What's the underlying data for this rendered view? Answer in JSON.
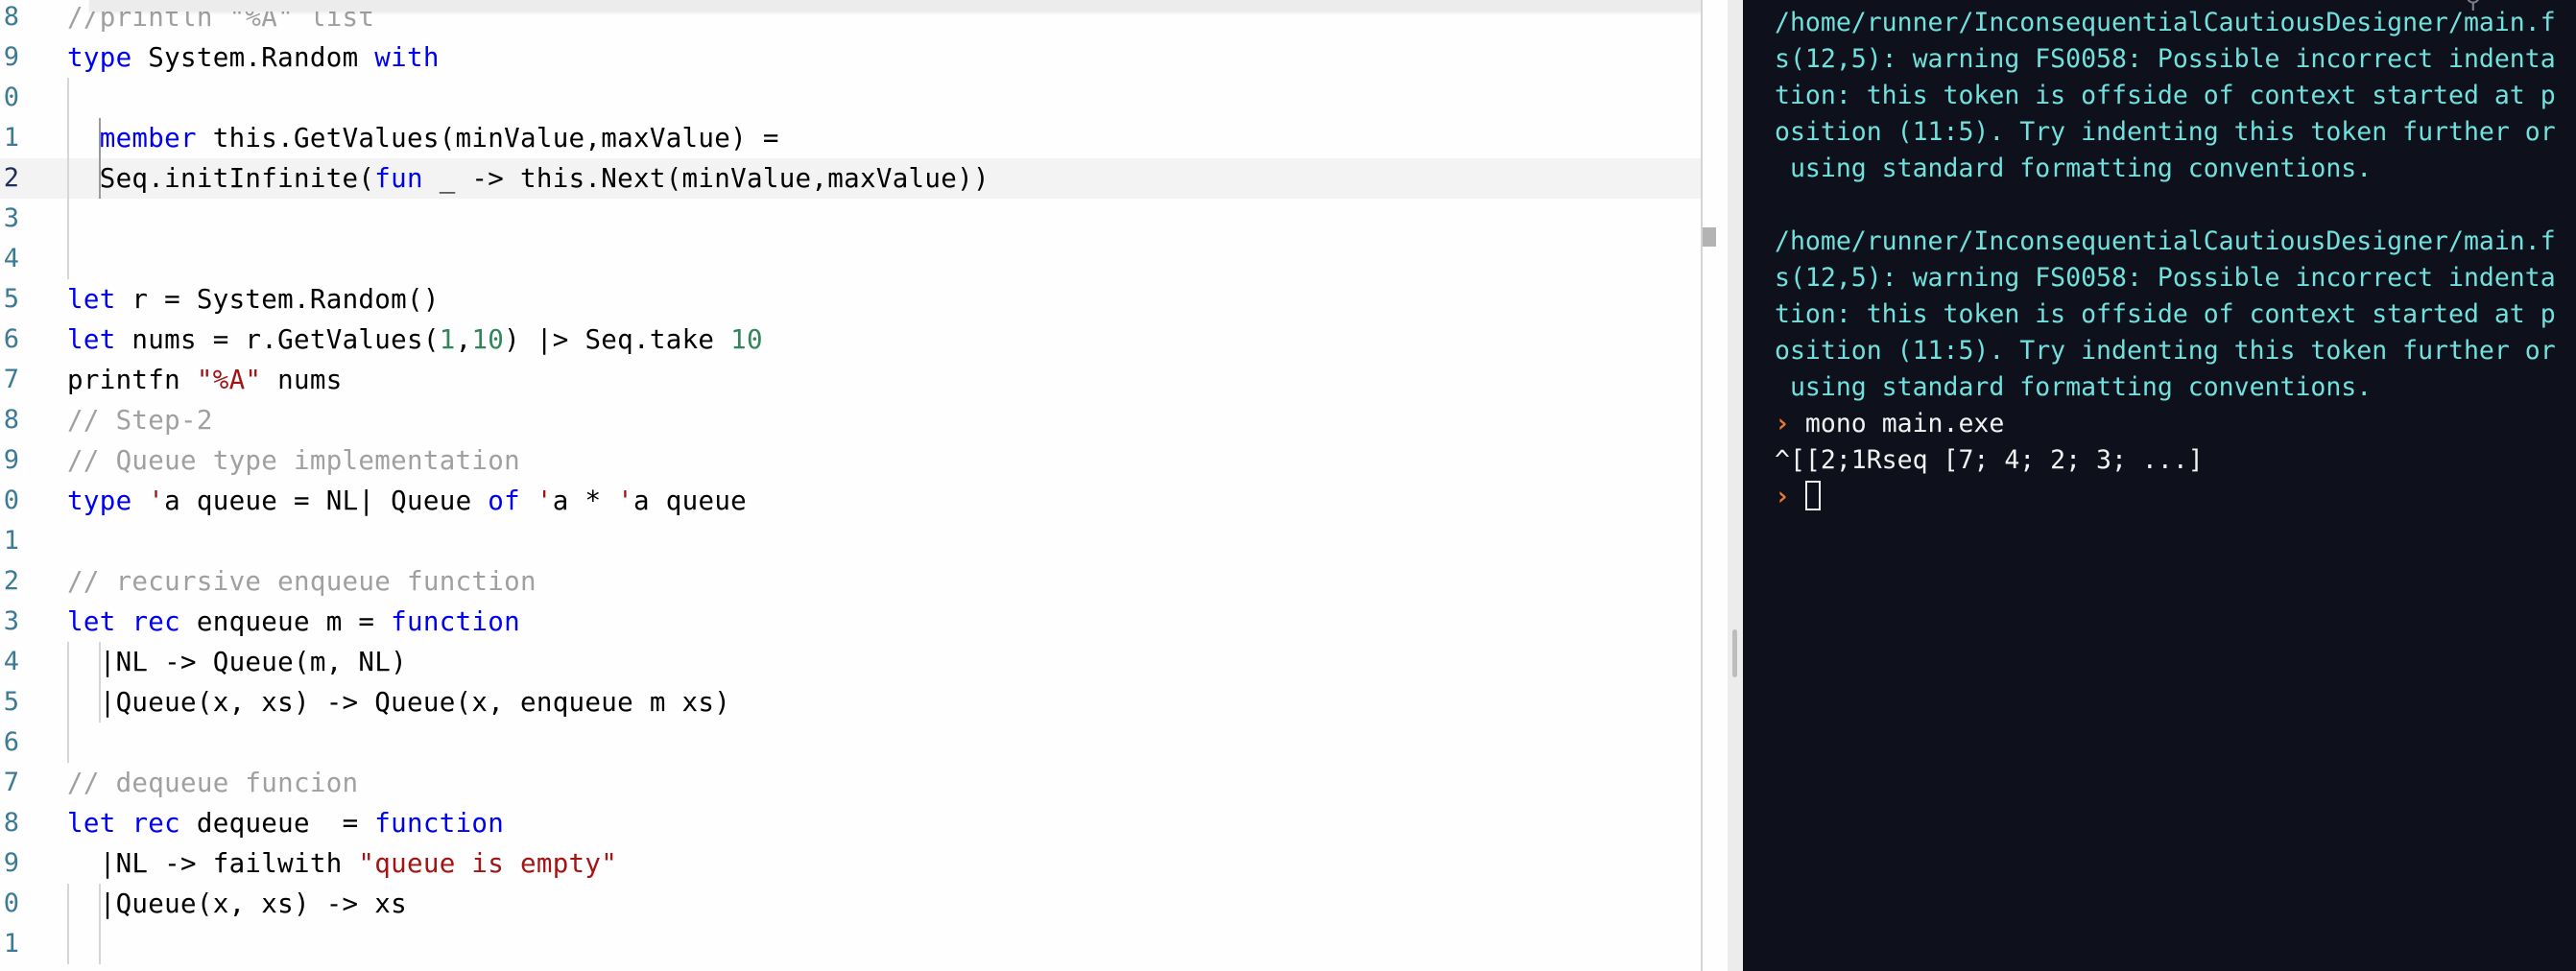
{
  "editor": {
    "lines": [
      {
        "num": "8",
        "tokens": [
          {
            "t": "//println \"%A\" list",
            "c": "cmt"
          }
        ]
      },
      {
        "num": "9",
        "tokens": [
          {
            "t": "type",
            "c": "kw"
          },
          {
            "t": " System.Random ",
            "c": ""
          },
          {
            "t": "with",
            "c": "kw"
          }
        ]
      },
      {
        "num": "0",
        "tokens": []
      },
      {
        "num": "1",
        "tokens": [
          {
            "t": "  member",
            "c": "kw"
          },
          {
            "t": " this.GetValues(minValue,maxValue) =",
            "c": ""
          }
        ]
      },
      {
        "num": "2",
        "active": true,
        "tokens": [
          {
            "t": "  Seq.initInfinite(",
            "c": ""
          },
          {
            "t": "fun",
            "c": "kw"
          },
          {
            "t": " _ -> this.Next(minValue,maxValue))",
            "c": ""
          }
        ]
      },
      {
        "num": "3",
        "tokens": []
      },
      {
        "num": "4",
        "tokens": []
      },
      {
        "num": "5",
        "tokens": [
          {
            "t": "let",
            "c": "kw"
          },
          {
            "t": " r = System.Random()",
            "c": ""
          }
        ]
      },
      {
        "num": "6",
        "tokens": [
          {
            "t": "let",
            "c": "kw"
          },
          {
            "t": " nums = r.GetValues(",
            "c": ""
          },
          {
            "t": "1",
            "c": "num"
          },
          {
            "t": ",",
            "c": ""
          },
          {
            "t": "10",
            "c": "num"
          },
          {
            "t": ") |> Seq.take ",
            "c": ""
          },
          {
            "t": "10",
            "c": "num"
          }
        ]
      },
      {
        "num": "7",
        "tokens": [
          {
            "t": "printfn ",
            "c": ""
          },
          {
            "t": "\"%A\"",
            "c": "str"
          },
          {
            "t": " nums",
            "c": ""
          }
        ]
      },
      {
        "num": "8",
        "tokens": [
          {
            "t": "// Step-2",
            "c": "cmt"
          }
        ]
      },
      {
        "num": "9",
        "tokens": [
          {
            "t": "// Queue type implementation",
            "c": "cmt"
          }
        ]
      },
      {
        "num": "0",
        "tokens": [
          {
            "t": "type",
            "c": "kw"
          },
          {
            "t": " ",
            "c": ""
          },
          {
            "t": "'",
            "c": "tick"
          },
          {
            "t": "a queue = NL| Queue ",
            "c": ""
          },
          {
            "t": "of",
            "c": "kw"
          },
          {
            "t": " ",
            "c": ""
          },
          {
            "t": "'",
            "c": "tick"
          },
          {
            "t": "a * ",
            "c": ""
          },
          {
            "t": "'",
            "c": "tick"
          },
          {
            "t": "a queue",
            "c": ""
          }
        ]
      },
      {
        "num": "1",
        "tokens": []
      },
      {
        "num": "2",
        "tokens": [
          {
            "t": "// recursive enqueue function",
            "c": "cmt"
          }
        ]
      },
      {
        "num": "3",
        "tokens": [
          {
            "t": "let",
            "c": "kw"
          },
          {
            "t": " ",
            "c": ""
          },
          {
            "t": "rec",
            "c": "kw"
          },
          {
            "t": " enqueue m = ",
            "c": ""
          },
          {
            "t": "function",
            "c": "kw"
          }
        ]
      },
      {
        "num": "4",
        "tokens": [
          {
            "t": "  |NL -> Queue(m, NL)",
            "c": ""
          }
        ]
      },
      {
        "num": "5",
        "tokens": [
          {
            "t": "  |Queue(x, xs) -> Queue(x, enqueue m xs)",
            "c": ""
          }
        ]
      },
      {
        "num": "6",
        "tokens": []
      },
      {
        "num": "7",
        "tokens": [
          {
            "t": "// dequeue funcion",
            "c": "cmt"
          }
        ]
      },
      {
        "num": "8",
        "tokens": [
          {
            "t": "let",
            "c": "kw"
          },
          {
            "t": " ",
            "c": ""
          },
          {
            "t": "rec",
            "c": "kw"
          },
          {
            "t": " dequeue  = ",
            "c": ""
          },
          {
            "t": "function",
            "c": "kw"
          }
        ]
      },
      {
        "num": "9",
        "tokens": [
          {
            "t": "  |NL -> failwith ",
            "c": ""
          },
          {
            "t": "\"queue is empty\"",
            "c": "str"
          }
        ]
      },
      {
        "num": "0",
        "tokens": [
          {
            "t": "  |Queue(x, xs) -> xs",
            "c": ""
          }
        ]
      },
      {
        "num": "1",
        "tokens": []
      }
    ]
  },
  "terminal": {
    "lines": [
      {
        "text": "/home/runner/InconsequentialCautiousDesigner/main.f",
        "kind": "warn"
      },
      {
        "text": "s(12,5): warning FS0058: Possible incorrect indenta",
        "kind": "warn"
      },
      {
        "text": "tion: this token is offside of context started at p",
        "kind": "warn"
      },
      {
        "text": "osition (11:5). Try indenting this token further or",
        "kind": "warn"
      },
      {
        "text": " using standard formatting conventions.",
        "kind": "warn"
      },
      {
        "text": "",
        "kind": "blank"
      },
      {
        "text": "/home/runner/InconsequentialCautiousDesigner/main.f",
        "kind": "warn"
      },
      {
        "text": "s(12,5): warning FS0058: Possible incorrect indenta",
        "kind": "warn"
      },
      {
        "text": "tion: this token is offside of context started at p",
        "kind": "warn"
      },
      {
        "text": "osition (11:5). Try indenting this token further or",
        "kind": "warn"
      },
      {
        "text": " using standard formatting conventions.",
        "kind": "warn"
      },
      {
        "text": "mono main.exe",
        "kind": "cmd"
      },
      {
        "text": "^[[2;1Rseq [7; 4; 2; 3; ...]",
        "kind": "out"
      },
      {
        "text": "",
        "kind": "prompt"
      }
    ],
    "prompt_glyph": "›",
    "icons": [
      "search-icon",
      "panel-icon"
    ]
  }
}
